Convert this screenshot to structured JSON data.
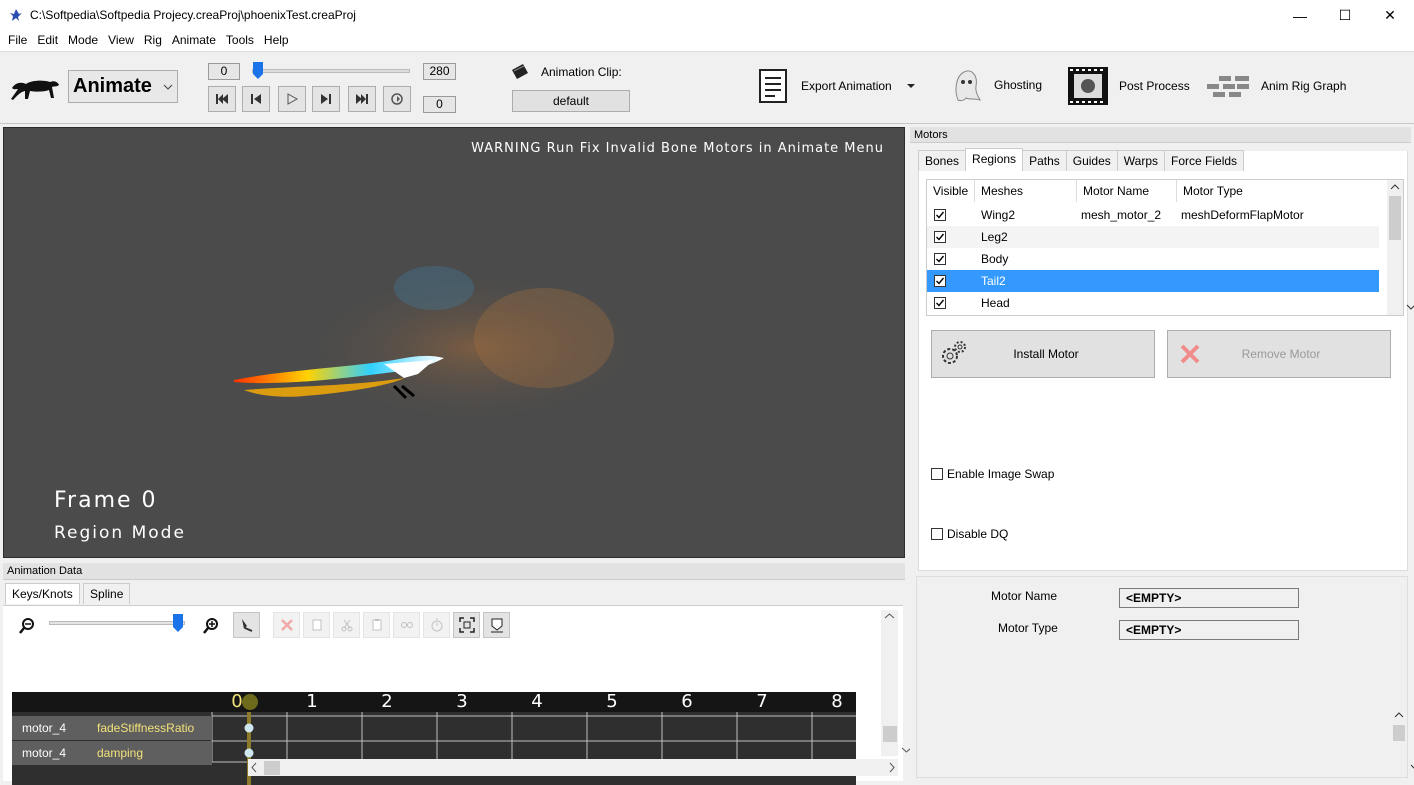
{
  "window": {
    "title": "C:\\Softpedia\\Softpedia Projecy.creaProj\\phoenixTest.creaProj",
    "min_label": "—",
    "max_label": "☐",
    "close_label": "✕"
  },
  "menu": [
    "File",
    "Edit",
    "Mode",
    "View",
    "Rig",
    "Animate",
    "Tools",
    "Help"
  ],
  "toolbar": {
    "mode": "Animate",
    "frame_start": "0",
    "frame_end": "280",
    "frame_current": "0",
    "slider_fraction": 0.0,
    "animation_clip_label": "Animation Clip:",
    "animation_clip_value": "default",
    "export_label": "Export Animation",
    "ghosting_label": "Ghosting",
    "post_process_label": "Post Process",
    "anim_rig_graph_label": "Anim Rig Graph"
  },
  "viewport": {
    "warning": "WARNING Run Fix Invalid Bone Motors in Animate Menu",
    "frame_text": "Frame 0",
    "mode_text": "Region Mode",
    "background": "#4b4b4b"
  },
  "animation_data": {
    "title": "Animation Data",
    "tabs": [
      "Keys/Knots",
      "Spline"
    ],
    "zoom_fraction": 0.97,
    "timeline_numbers": [
      "0",
      "1",
      "2",
      "3",
      "4",
      "5",
      "6",
      "7",
      "8"
    ],
    "rows": [
      {
        "motor": "motor_4",
        "param": "fadeStiffnessRatio"
      },
      {
        "motor": "motor_4",
        "param": "damping"
      }
    ]
  },
  "motors": {
    "title": "Motors",
    "tabs": [
      "Bones",
      "Regions",
      "Paths",
      "Guides",
      "Warps",
      "Force Fields"
    ],
    "active_tab": "Regions",
    "columns": [
      "Visible",
      "Meshes",
      "Motor Name",
      "Motor Type"
    ],
    "rows": [
      {
        "visible": true,
        "mesh": "Wing2",
        "motor_name": "mesh_motor_2",
        "motor_type": "meshDeformFlapMotor"
      },
      {
        "visible": true,
        "mesh": "Leg2",
        "motor_name": "",
        "motor_type": ""
      },
      {
        "visible": true,
        "mesh": "Body",
        "motor_name": "",
        "motor_type": ""
      },
      {
        "visible": true,
        "mesh": "Tail2",
        "motor_name": "",
        "motor_type": ""
      },
      {
        "visible": true,
        "mesh": "Head",
        "motor_name": "",
        "motor_type": ""
      }
    ],
    "selected_row": 3,
    "install_label": "Install Motor",
    "remove_label": "Remove Motor",
    "enable_image_swap": "Enable Image Swap",
    "disable_dq": "Disable DQ",
    "motor_name_label": "Motor Name",
    "motor_name_value": "<EMPTY>",
    "motor_type_label": "Motor Type",
    "motor_type_value": "<EMPTY>",
    "accent": "#3399ff"
  }
}
